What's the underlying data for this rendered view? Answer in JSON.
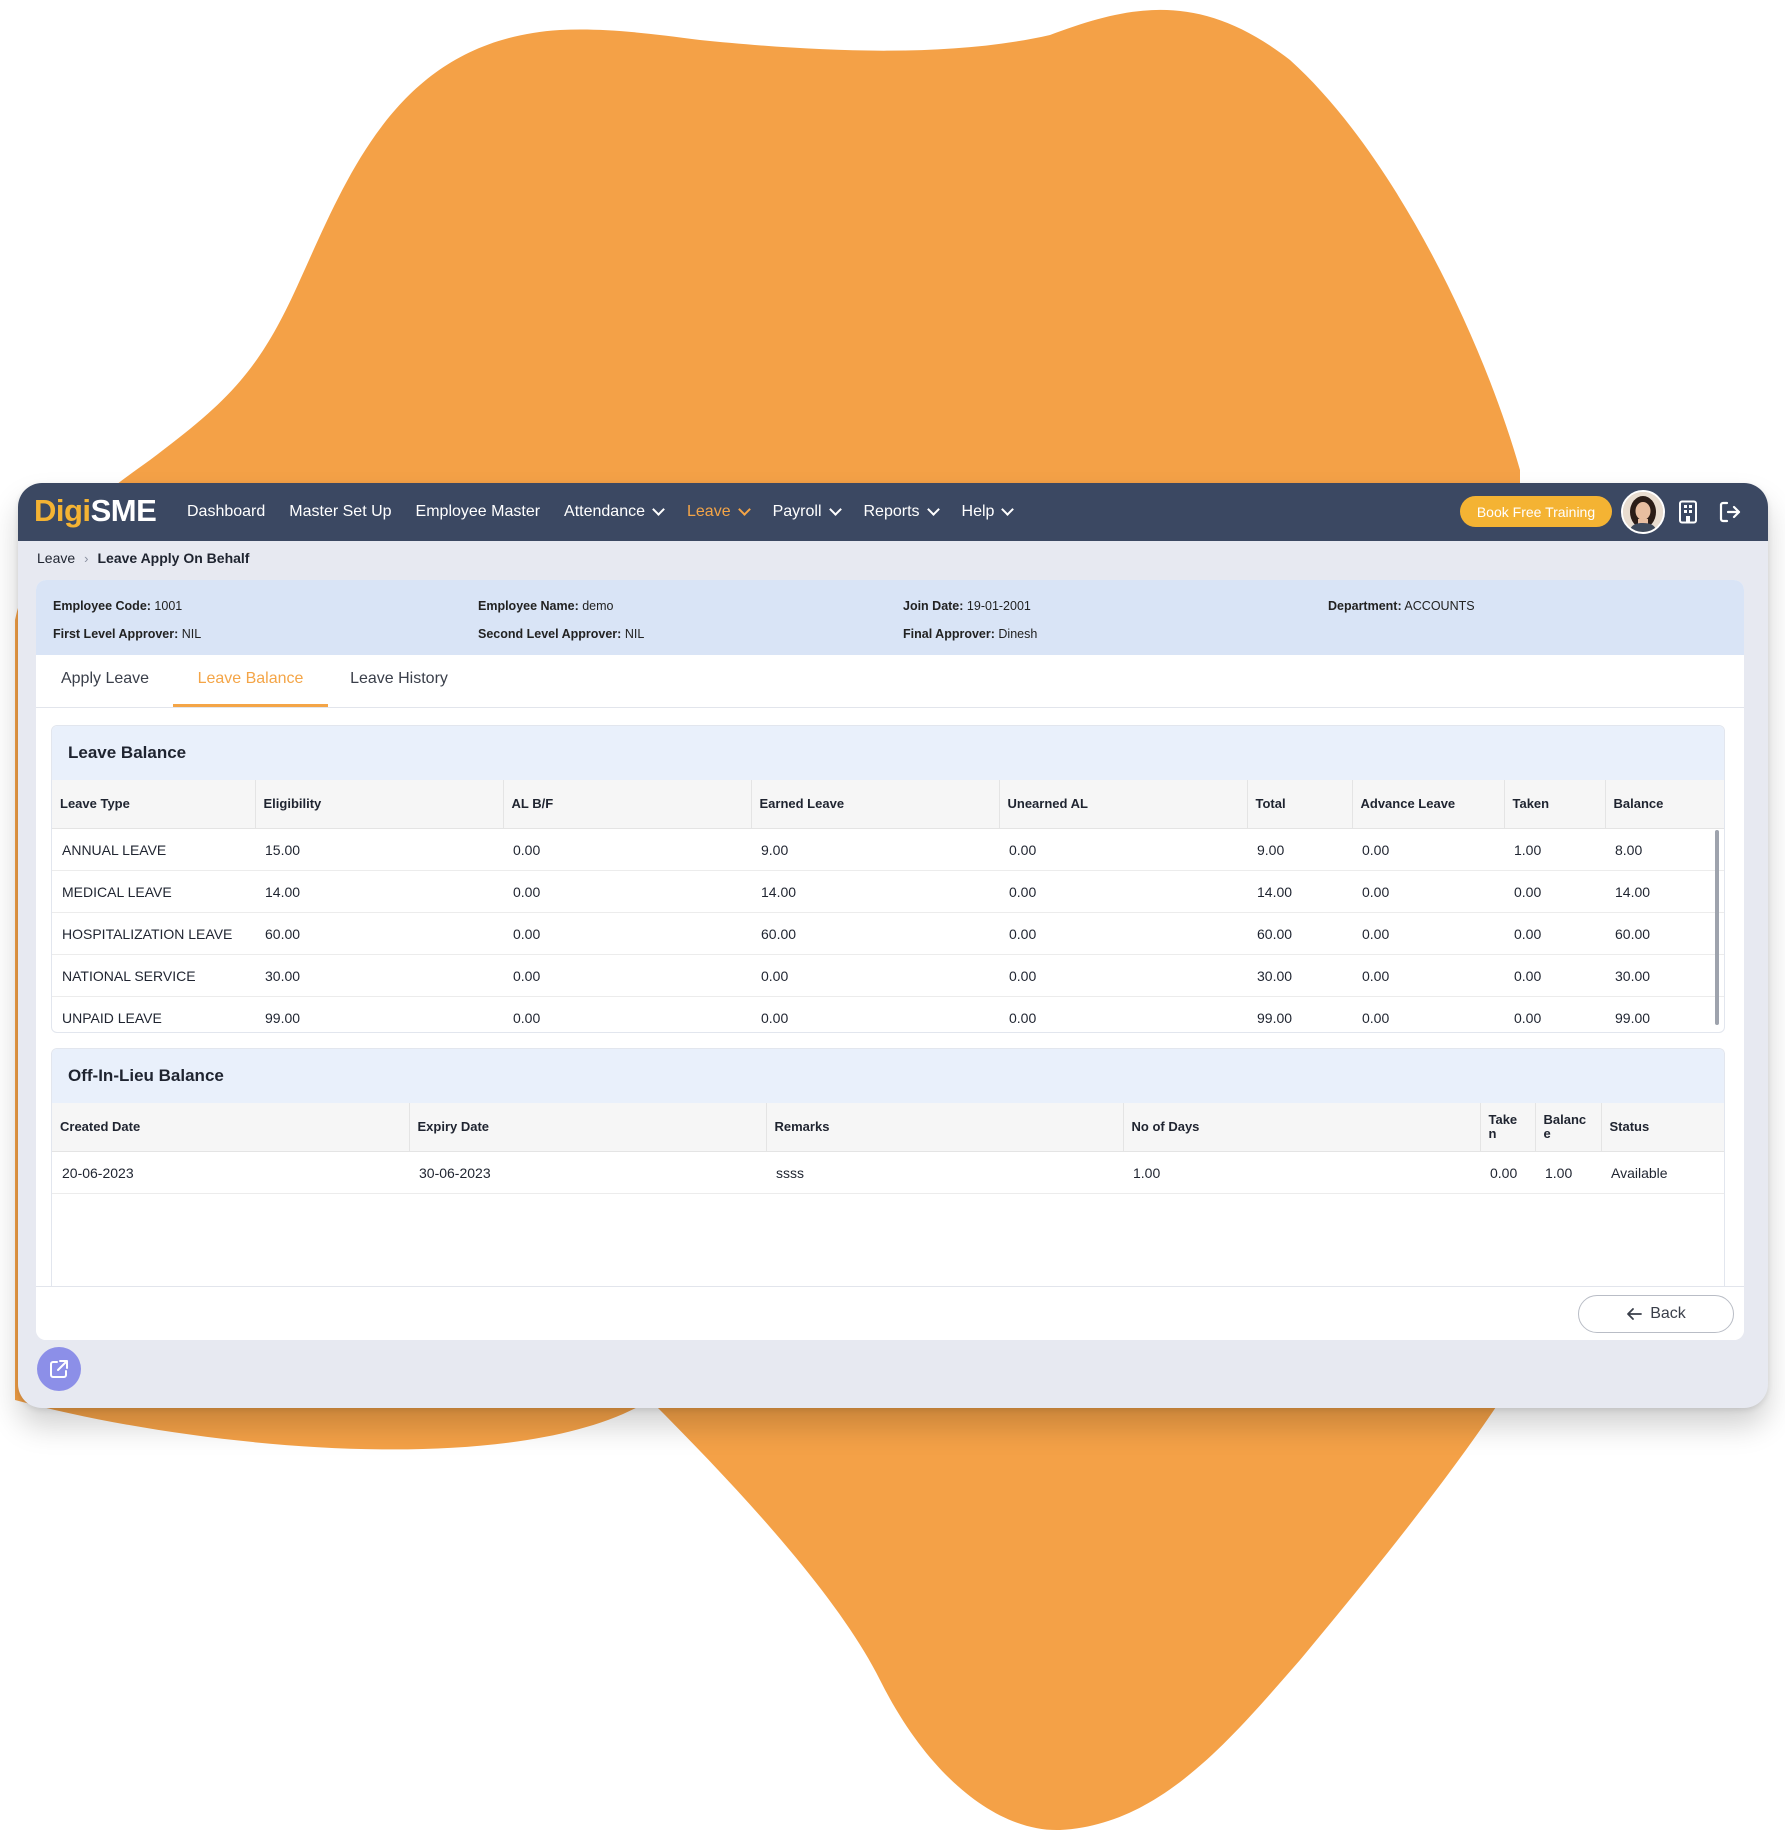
{
  "brand": {
    "prefix": "Digi",
    "suffix": "SME"
  },
  "nav": [
    {
      "label": "Dashboard",
      "dropdown": false,
      "active": false
    },
    {
      "label": "Master Set Up",
      "dropdown": false,
      "active": false
    },
    {
      "label": "Employee Master",
      "dropdown": false,
      "active": false
    },
    {
      "label": "Attendance",
      "dropdown": true,
      "active": false
    },
    {
      "label": "Leave",
      "dropdown": true,
      "active": true
    },
    {
      "label": "Payroll",
      "dropdown": true,
      "active": false
    },
    {
      "label": "Reports",
      "dropdown": true,
      "active": false
    },
    {
      "label": "Help",
      "dropdown": true,
      "active": false
    }
  ],
  "header_actions": {
    "book_training": "Book Free Training",
    "icons": [
      "user-avatar",
      "building-icon",
      "logout-icon"
    ]
  },
  "breadcrumb": {
    "parent": "Leave",
    "current": "Leave Apply On Behalf"
  },
  "employee_info": {
    "code_label": "Employee Code:",
    "code": "1001",
    "name_label": "Employee Name:",
    "name": "demo",
    "join_label": "Join Date:",
    "join_date": "19-01-2001",
    "dept_label": "Department:",
    "department": "ACCOUNTS",
    "first_label": "First Level Approver:",
    "first_approver": "NIL",
    "second_label": "Second Level Approver:",
    "second_approver": "NIL",
    "final_label": "Final Approver:",
    "final_approver": "Dinesh"
  },
  "tabs": [
    {
      "label": "Apply Leave",
      "active": false
    },
    {
      "label": "Leave Balance",
      "active": true
    },
    {
      "label": "Leave History",
      "active": false
    }
  ],
  "leave_balance": {
    "title": "Leave Balance",
    "columns": [
      "Leave Type",
      "Eligibility",
      "AL B/F",
      "Earned Leave",
      "Unearned AL",
      "Total",
      "Advance Leave",
      "Taken",
      "Balance"
    ],
    "rows": [
      [
        "ANNUAL LEAVE",
        "15.00",
        "0.00",
        "9.00",
        "0.00",
        "9.00",
        "0.00",
        "1.00",
        "8.00"
      ],
      [
        "MEDICAL LEAVE",
        "14.00",
        "0.00",
        "14.00",
        "0.00",
        "14.00",
        "0.00",
        "0.00",
        "14.00"
      ],
      [
        "HOSPITALIZATION LEAVE",
        "60.00",
        "0.00",
        "60.00",
        "0.00",
        "60.00",
        "0.00",
        "0.00",
        "60.00"
      ],
      [
        "NATIONAL SERVICE",
        "30.00",
        "0.00",
        "0.00",
        "0.00",
        "30.00",
        "0.00",
        "0.00",
        "30.00"
      ],
      [
        "UNPAID LEAVE",
        "99.00",
        "0.00",
        "0.00",
        "0.00",
        "99.00",
        "0.00",
        "0.00",
        "99.00"
      ]
    ]
  },
  "off_in_lieu": {
    "title": "Off-In-Lieu Balance",
    "columns": [
      "Created Date",
      "Expiry Date",
      "Remarks",
      "No of Days",
      "Take\nn",
      "Balanc\ne",
      "Status"
    ],
    "rows": [
      [
        "20-06-2023",
        "30-06-2023",
        "ssss",
        "1.00",
        "0.00",
        "1.00",
        "Available"
      ]
    ]
  },
  "back_label": "Back",
  "colors": {
    "accent": "#f4a547",
    "topbar": "#3b4862",
    "blob": "#f4a147",
    "info_bg": "#d9e4f6",
    "fab": "#8c8fe8"
  }
}
